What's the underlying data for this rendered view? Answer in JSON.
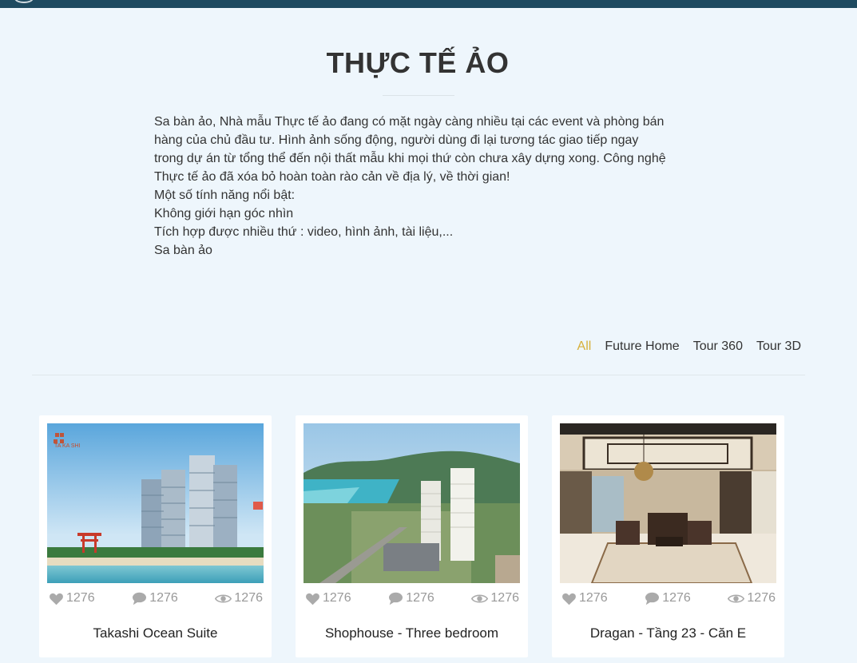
{
  "page": {
    "title": "THỰC TẾ ẢO",
    "intro_lines": [
      "Sa bàn ảo, Nhà mẫu Thực tế ảo đang có mặt ngày càng nhiều tại các event và phòng bán",
      "hàng của chủ đầu tư. Hình ảnh sống động, người dùng đi lại tương tác giao tiếp ngay",
      "trong dự án từ tổng thể đến nội thất mẫu khi mọi thứ còn chưa xây dựng xong. Công nghệ",
      "Thực tế ảo đã xóa bỏ hoàn toàn rào cản về địa lý, về thời gian!",
      "Một số tính năng nổi bật:",
      "Không giới hạn góc nhìn",
      "Tích hợp được nhiều thứ : video, hình ảnh, tài liệu,...",
      "Sa bàn ảo"
    ]
  },
  "filters": [
    {
      "label": "All",
      "active": true
    },
    {
      "label": "Future Home",
      "active": false
    },
    {
      "label": "Tour 360",
      "active": false
    },
    {
      "label": "Tour 3D",
      "active": false
    }
  ],
  "colors": {
    "accent": "#d7b03a",
    "topbar": "#1e4a60",
    "background": "#eef6fc"
  },
  "cards": [
    {
      "title": "Takashi Ocean Suite",
      "likes": "1276",
      "comments": "1276",
      "views": "1276",
      "image": "beach-towers",
      "image_text": "TA KA SHI"
    },
    {
      "title": "Shophouse - Three bedroom",
      "likes": "1276",
      "comments": "1276",
      "views": "1276",
      "image": "city-aerial"
    },
    {
      "title": "Dragan - Tầng 23 - Căn E",
      "likes": "1276",
      "comments": "1276",
      "views": "1276",
      "image": "luxury-interior"
    }
  ]
}
